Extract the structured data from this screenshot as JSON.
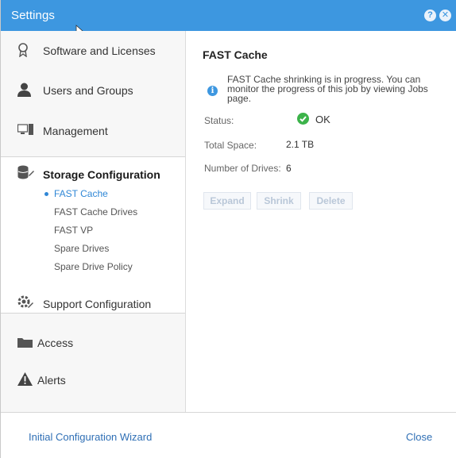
{
  "window": {
    "title": "Settings",
    "help_icon": "help-icon",
    "close_icon": "close-icon"
  },
  "sidebar": {
    "items": [
      {
        "label": "Software and Licenses",
        "icon": "award-icon"
      },
      {
        "label": "Users and Groups",
        "icon": "user-icon"
      },
      {
        "label": "Management",
        "icon": "monitor-icon"
      },
      {
        "label": "Storage Configuration",
        "icon": "database-icon"
      },
      {
        "label": "Support Configuration",
        "icon": "gear-wrench-icon"
      },
      {
        "label": "Access",
        "icon": "folder-icon"
      },
      {
        "label": "Alerts",
        "icon": "warning-icon"
      }
    ],
    "storage_subitems": [
      {
        "label": "FAST Cache",
        "active": true
      },
      {
        "label": "FAST Cache Drives"
      },
      {
        "label": "FAST VP"
      },
      {
        "label": "Spare Drives"
      },
      {
        "label": "Spare Drive Policy"
      }
    ]
  },
  "main": {
    "heading": "FAST Cache",
    "notice_lines": [
      "FAST Cache shrinking is in progress. You can",
      "monitor the progress of this job by viewing Jobs",
      "page."
    ],
    "fields": [
      {
        "label": "Status:",
        "value": "OK"
      },
      {
        "label": "Total Space:",
        "value": "2.1 TB"
      },
      {
        "label": "Number of Drives:",
        "value": "6"
      }
    ],
    "buttons": {
      "expand": "Expand",
      "shrink": "Shrink",
      "delete": "Delete"
    }
  },
  "footer": {
    "wizard_link": "Initial Configuration Wizard",
    "close_link": "Close"
  },
  "colors": {
    "titlebar": "#3d97e0",
    "link": "#2f6fb5",
    "active": "#2f87d6",
    "ok": "#3cb34a"
  }
}
